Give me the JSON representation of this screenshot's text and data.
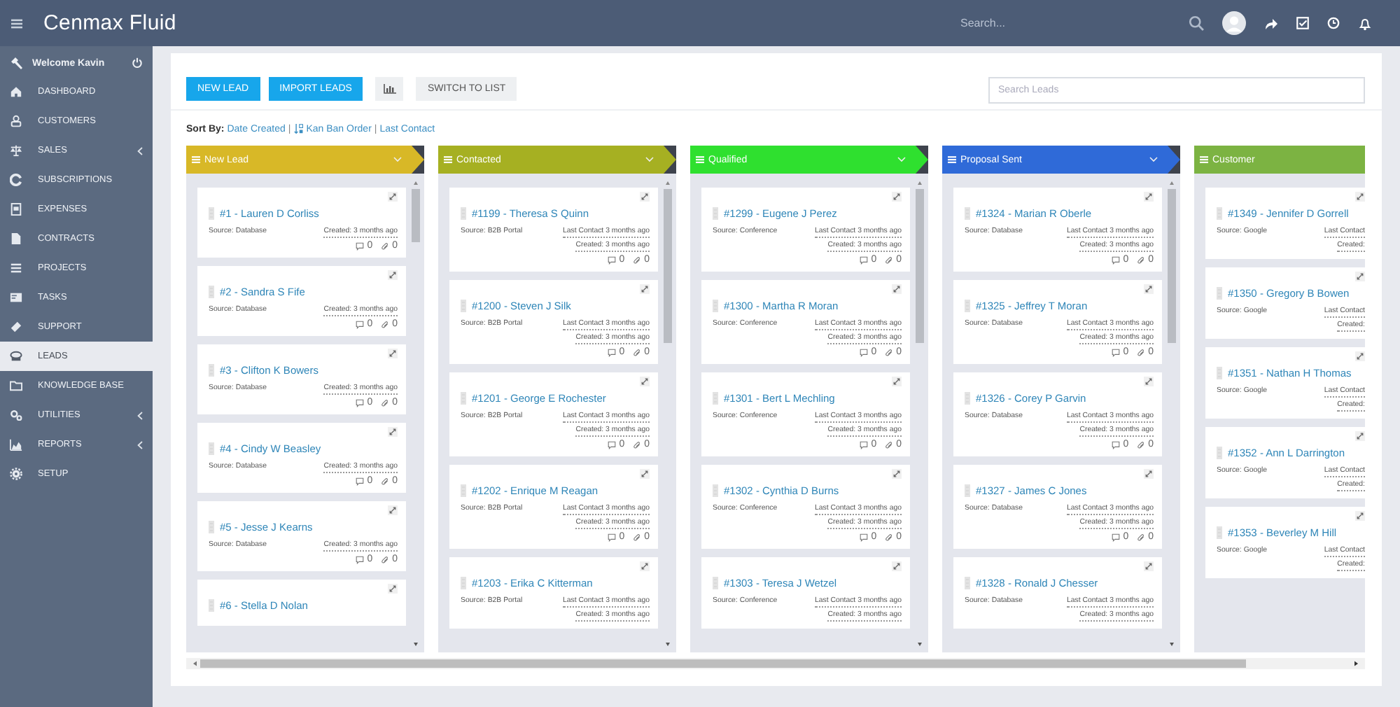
{
  "header": {
    "title": "Cenmax Fluid",
    "search": {
      "placeholder": "Search..."
    }
  },
  "sidebar": {
    "welcome": "Welcome Kavin",
    "items": [
      {
        "label": "DASHBOARD",
        "selected": false,
        "submenu": false
      },
      {
        "label": "CUSTOMERS",
        "selected": false,
        "submenu": false
      },
      {
        "label": "SALES",
        "selected": false,
        "submenu": true
      },
      {
        "label": "SUBSCRIPTIONS",
        "selected": false,
        "submenu": false
      },
      {
        "label": "EXPENSES",
        "selected": false,
        "submenu": false
      },
      {
        "label": "CONTRACTS",
        "selected": false,
        "submenu": false
      },
      {
        "label": "PROJECTS",
        "selected": false,
        "submenu": false
      },
      {
        "label": "TASKS",
        "selected": false,
        "submenu": false
      },
      {
        "label": "SUPPORT",
        "selected": false,
        "submenu": false
      },
      {
        "label": "LEADS",
        "selected": true,
        "submenu": false
      },
      {
        "label": "KNOWLEDGE BASE",
        "selected": false,
        "submenu": false
      },
      {
        "label": "UTILITIES",
        "selected": false,
        "submenu": true
      },
      {
        "label": "REPORTS",
        "selected": false,
        "submenu": true
      },
      {
        "label": "SETUP",
        "selected": false,
        "submenu": false
      }
    ]
  },
  "toolbar": {
    "buttons": [
      {
        "label": "NEW LEAD",
        "kind": "primary"
      },
      {
        "label": "IMPORT LEADS",
        "kind": "primary"
      },
      {
        "kind": "chart"
      },
      {
        "label": "SWITCH TO LIST",
        "kind": "default"
      }
    ],
    "search": {
      "placeholder": "Search Leads"
    }
  },
  "sort": {
    "label": "Sort By:",
    "items": [
      {
        "kind": "link",
        "text": "Date Created"
      },
      {
        "kind": "separator",
        "text": "|"
      },
      {
        "kind": "icon_link",
        "text": "Kan Ban Order"
      },
      {
        "kind": "separator",
        "text": "|"
      },
      {
        "kind": "link",
        "text": "Last Contact"
      }
    ]
  },
  "columns": [
    {
      "title": "New Lead",
      "color": "#d8b827",
      "menu_toggle": true,
      "scrollbar": true,
      "cards": [
        {
          "title": "#1 - Lauren D Corliss",
          "source": "Source: Database",
          "created": "Created: 3 months ago",
          "comments": "0",
          "attachments": "0"
        },
        {
          "title": "#2 - Sandra S Fife",
          "source": "Source: Database",
          "created": "Created: 3 months ago",
          "comments": "0",
          "attachments": "0"
        },
        {
          "title": "#3 - Clifton K Bowers",
          "source": "Source: Database",
          "created": "Created: 3 months ago",
          "comments": "0",
          "attachments": "0"
        },
        {
          "title": "#4 - Cindy W Beasley",
          "source": "Source: Database",
          "created": "Created: 3 months ago",
          "comments": "0",
          "attachments": "0"
        },
        {
          "title": "#5 - Jesse J Kearns",
          "source": "Source: Database",
          "created": "Created: 3 months ago",
          "comments": "0",
          "attachments": "0"
        },
        {
          "title": "#6 - Stella D Nolan"
        }
      ]
    },
    {
      "title": "Contacted",
      "color": "#a6b022",
      "menu_toggle": true,
      "scrollbar": true,
      "cards": [
        {
          "title": "#1199 - Theresa S Quinn",
          "source": "Source: B2B Portal",
          "last_contact": "Last Contact 3 months ago",
          "created": "Created: 3 months ago",
          "comments": "0",
          "attachments": "0"
        },
        {
          "title": "#1200 - Steven J Silk",
          "source": "Source: B2B Portal",
          "last_contact": "Last Contact 3 months ago",
          "created": "Created: 3 months ago",
          "comments": "0",
          "attachments": "0"
        },
        {
          "title": "#1201 - George E Rochester",
          "source": "Source: B2B Portal",
          "last_contact": "Last Contact 3 months ago",
          "created": "Created: 3 months ago",
          "comments": "0",
          "attachments": "0"
        },
        {
          "title": "#1202 - Enrique M Reagan",
          "source": "Source: B2B Portal",
          "last_contact": "Last Contact 3 months ago",
          "created": "Created: 3 months ago",
          "comments": "0",
          "attachments": "0"
        },
        {
          "title": "#1203 - Erika C Kitterman",
          "source": "Source: B2B Portal",
          "last_contact": "Last Contact 3 months ago",
          "created": "Created: 3 months ago"
        }
      ]
    },
    {
      "title": "Qualified",
      "color": "#2fe02f",
      "menu_toggle": true,
      "scrollbar": true,
      "cards": [
        {
          "title": "#1299 - Eugene J Perez",
          "source": "Source: Conference",
          "last_contact": "Last Contact 3 months ago",
          "created": "Created: 3 months ago",
          "comments": "0",
          "attachments": "0"
        },
        {
          "title": "#1300 - Martha R Moran",
          "source": "Source: Conference",
          "last_contact": "Last Contact 3 months ago",
          "created": "Created: 3 months ago",
          "comments": "0",
          "attachments": "0"
        },
        {
          "title": "#1301 - Bert L Mechling",
          "source": "Source: Conference",
          "last_contact": "Last Contact 3 months ago",
          "created": "Created: 3 months ago",
          "comments": "0",
          "attachments": "0"
        },
        {
          "title": "#1302 - Cynthia D Burns",
          "source": "Source: Conference",
          "last_contact": "Last Contact 3 months ago",
          "created": "Created: 3 months ago",
          "comments": "0",
          "attachments": "0"
        },
        {
          "title": "#1303 - Teresa J Wetzel",
          "source": "Source: Conference",
          "last_contact": "Last Contact 3 months ago",
          "created": "Created: 3 months ago"
        }
      ]
    },
    {
      "title": "Proposal Sent",
      "color": "#2f6ad8",
      "menu_toggle": true,
      "scrollbar": true,
      "cards": [
        {
          "title": "#1324 - Marian R Oberle",
          "source": "Source: Database",
          "last_contact": "Last Contact 3 months ago",
          "created": "Created: 3 months ago",
          "comments": "0",
          "attachments": "0"
        },
        {
          "title": "#1325 - Jeffrey T Moran",
          "source": "Source: Database",
          "last_contact": "Last Contact 3 months ago",
          "created": "Created: 3 months ago",
          "comments": "0",
          "attachments": "0"
        },
        {
          "title": "#1326 - Corey P Garvin",
          "source": "Source: Database",
          "last_contact": "Last Contact 3 months ago",
          "created": "Created: 3 months ago",
          "comments": "0",
          "attachments": "0"
        },
        {
          "title": "#1327 - James C Jones",
          "source": "Source: Database",
          "last_contact": "Last Contact 3 months ago",
          "created": "Created: 3 months ago",
          "comments": "0",
          "attachments": "0"
        },
        {
          "title": "#1328 - Ronald J Chesser",
          "source": "Source: Database",
          "last_contact": "Last Contact 3 months ago",
          "created": "Created: 3 months ago"
        }
      ]
    },
    {
      "title": "Customer",
      "color": "#7cb342",
      "menu_toggle": false,
      "scrollbar": false,
      "cards": [
        {
          "title": "#1349 - Jennifer D Gorrell",
          "source": "Source: Google",
          "last_contact": "Last Contact",
          "created": "Created:"
        },
        {
          "title": "#1350 - Gregory B Bowen",
          "source": "Source: Google",
          "last_contact": "Last Contact",
          "created": "Created:"
        },
        {
          "title": "#1351 - Nathan H Thomas",
          "source": "Source: Google",
          "last_contact": "Last Contact",
          "created": "Created:"
        },
        {
          "title": "#1352 - Ann L Darrington",
          "source": "Source: Google",
          "last_contact": "Last Contact",
          "created": "Created:"
        },
        {
          "title": "#1353 - Beverley M Hill",
          "source": "Source: Google",
          "last_contact": "Last Contact",
          "created": "Created:"
        }
      ]
    }
  ]
}
